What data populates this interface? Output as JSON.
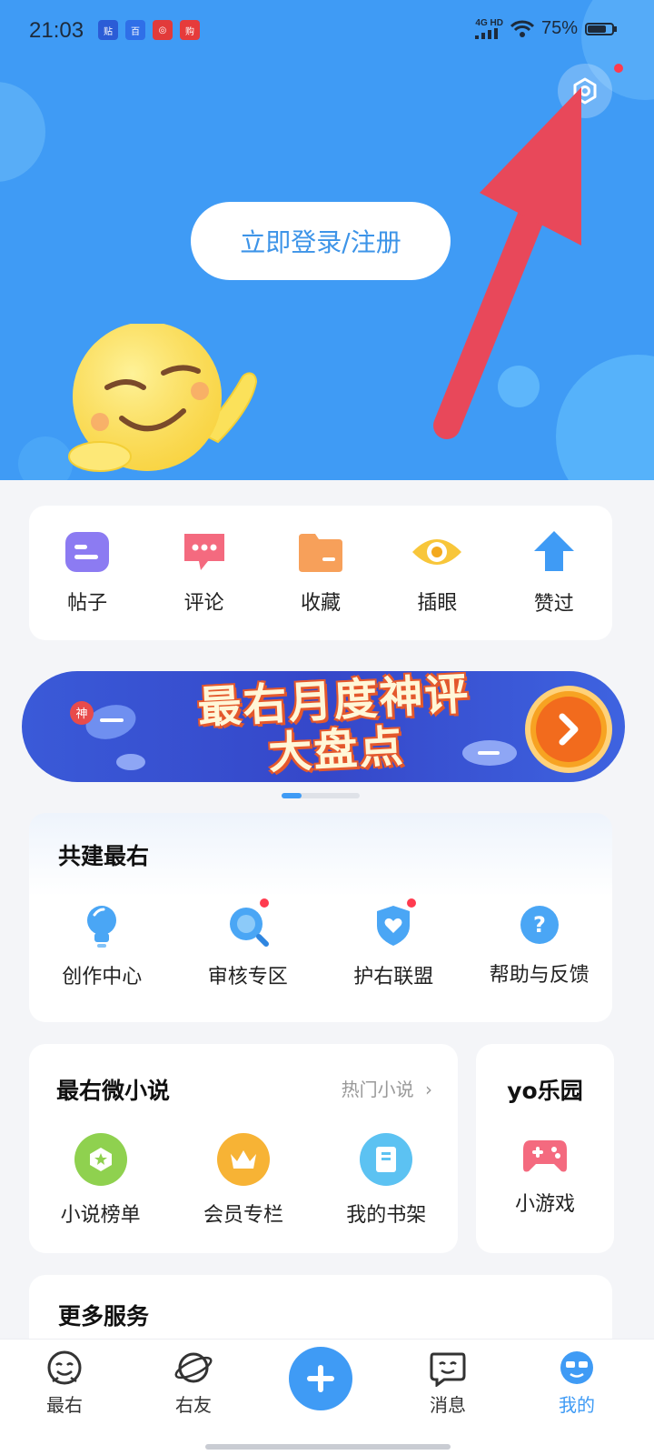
{
  "status_bar": {
    "time": "21:03",
    "network": "4G HD",
    "battery": "75%"
  },
  "header": {
    "login_label": "立即登录/注册",
    "settings_has_badge": true
  },
  "quick_actions": [
    {
      "label": "帖子",
      "icon": "post-icon",
      "color": "#8c7bf2"
    },
    {
      "label": "评论",
      "icon": "comment-icon",
      "color": "#f46a7f"
    },
    {
      "label": "收藏",
      "icon": "folder-icon",
      "color": "#f7a05a"
    },
    {
      "label": "插眼",
      "icon": "eye-icon",
      "color": "#f8c63a"
    },
    {
      "label": "赞过",
      "icon": "thumb-up-arrow-icon",
      "color": "#3f9bf5"
    }
  ],
  "banner": {
    "line1": "最右月度神评",
    "line2": "大盘点",
    "badge": "神"
  },
  "co_build": {
    "title": "共建最右",
    "items": [
      {
        "label": "创作中心",
        "icon": "lightbulb-icon",
        "badge": false
      },
      {
        "label": "审核专区",
        "icon": "magnifier-icon",
        "badge": true
      },
      {
        "label": "护右联盟",
        "icon": "shield-heart-icon",
        "badge": true
      },
      {
        "label": "帮助与反馈",
        "icon": "help-icon",
        "badge": false
      }
    ]
  },
  "novel": {
    "title": "最右微小说",
    "more_label": "热门小说",
    "items": [
      {
        "label": "小说榜单",
        "icon": "ranking-icon",
        "color": "#8fd14f"
      },
      {
        "label": "会员专栏",
        "icon": "crown-icon",
        "color": "#f7b335"
      },
      {
        "label": "我的书架",
        "icon": "book-icon",
        "color": "#5cc2f2"
      }
    ]
  },
  "yo_park": {
    "title": "yo乐园",
    "item_label": "小游戏",
    "icon": "gamepad-icon"
  },
  "more_services": {
    "title": "更多服务"
  },
  "tabbar": {
    "tabs": [
      {
        "label": "最右",
        "icon": "face-icon"
      },
      {
        "label": "右友",
        "icon": "planet-icon"
      },
      {
        "label": "消息",
        "icon": "chat-face-icon"
      },
      {
        "label": "我的",
        "icon": "profile-face-icon"
      }
    ],
    "active_color": "#3f9bf5"
  }
}
